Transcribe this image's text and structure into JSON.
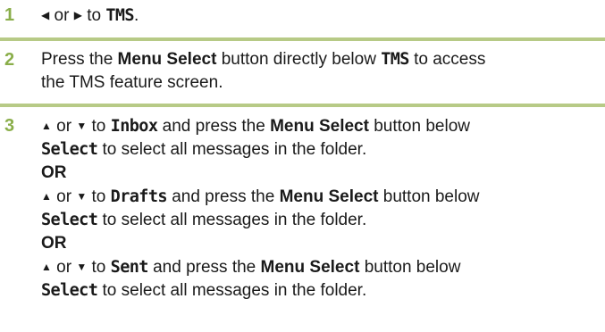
{
  "steps": [
    {
      "number": "1",
      "left_icon": "◀",
      "or1": "or",
      "right_icon": "▶",
      "to": "to",
      "target": "TMS",
      "end": "."
    },
    {
      "number": "2",
      "press": "Press the",
      "button": "Menu Select",
      "middle": "button directly below",
      "target": "TMS",
      "end1": "to access",
      "line2": "the TMS feature screen."
    },
    {
      "number": "3",
      "options": [
        {
          "up_icon": "▲",
          "or": "or",
          "down_icon": "▼",
          "to": "to",
          "folder": "Inbox",
          "mid": "and press the",
          "button": "Menu Select",
          "after": "button below",
          "select_label": "Select",
          "tail": "to select all messages in the folder."
        },
        {
          "up_icon": "▲",
          "or": "or",
          "down_icon": "▼",
          "to": "to",
          "folder": "Drafts",
          "mid": "and press the",
          "button": "Menu Select",
          "after": "button below",
          "select_label": "Select",
          "tail": "to select all messages in the folder."
        },
        {
          "up_icon": "▲",
          "or": "or",
          "down_icon": "▼",
          "to": "to",
          "folder": "Sent",
          "mid": "and press the",
          "button": "Menu Select",
          "after": "button below",
          "select_label": "Select",
          "tail": "to select all messages in the folder."
        }
      ],
      "or_separator": "OR"
    }
  ],
  "colors": {
    "number": "#8aae4a",
    "rule": "#b7ca86"
  }
}
